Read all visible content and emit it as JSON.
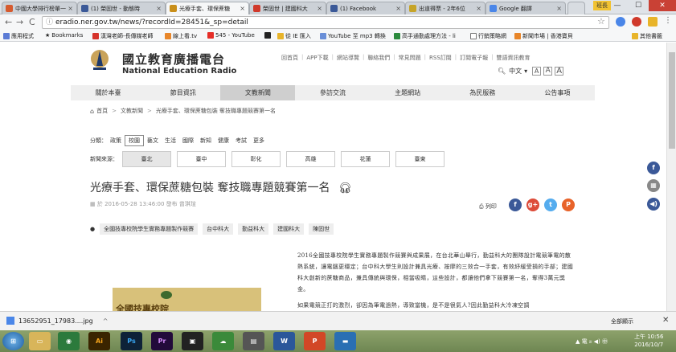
{
  "browser": {
    "tabs": [
      {
        "label": "中國大學排行榜單一",
        "color": "#d65b2f",
        "active": false
      },
      {
        "label": "(1) 榮固世 - 動態時",
        "color": "#3b5998",
        "active": false
      },
      {
        "label": "光療手套、環保蔗糖",
        "color": "#c98f1a",
        "active": true
      },
      {
        "label": "榮固世 | 建國科大",
        "color": "#d0392b",
        "active": false
      },
      {
        "label": "(1) Facebook",
        "color": "#3b5998",
        "active": false
      },
      {
        "label": "出道得票 - 2年6位",
        "color": "#c6a428",
        "active": false
      },
      {
        "label": "Google 翻譯",
        "color": "#4a86e8",
        "active": false
      }
    ],
    "profile_label": "班長",
    "url": "eradio.ner.gov.tw/news/?recordId=28451&_sp=detail",
    "bookmarks": [
      {
        "label": "應用程式",
        "color": "#5b7bd5"
      },
      {
        "label": "Bookmarks",
        "color": "#333333"
      },
      {
        "label": "漢灣老師-長傳媒老師",
        "color": "#d6332b"
      },
      {
        "label": "線上看.tv",
        "color": "#e8862a"
      },
      {
        "label": "545 - YouTube",
        "color": "#e52d27"
      },
      {
        "label": "",
        "color": "#222222"
      },
      {
        "label": "從 IE 匯入",
        "color": "#e8b42a"
      },
      {
        "label": "YouTube 至 mp3 轉換",
        "color": "#6a8fd8"
      },
      {
        "label": "高手通勤處理方法 - li",
        "color": "#2b8a3e"
      },
      {
        "label": "行銷策略網",
        "color": "#777777"
      },
      {
        "label": "新聞市場 | 香港寶貝",
        "color": "#e8862a"
      }
    ],
    "other_bookmarks": "其他書籤"
  },
  "site": {
    "name_zh": "國立教育廣播電台",
    "name_en": "National Education Radio",
    "top_links": [
      "回首頁",
      "APP下載",
      "網站導覽",
      "聯絡我們",
      "常見問題",
      "RSS訂閱",
      "訂閱電子報",
      "雙語資訊教育"
    ],
    "language": "中文",
    "font_sizes": [
      "A",
      "A",
      "A"
    ],
    "nav": [
      "關於本臺",
      "節目資訊",
      "文教新聞",
      "參訪交流",
      "主題網站",
      "為民服務",
      "公告事項"
    ],
    "nav_active_index": 2
  },
  "breadcrumb": [
    "首頁",
    "文教新聞",
    "光療手套、環保蔗糖包裝 奪技職專題競賽第一名"
  ],
  "categories": {
    "label": "分類：",
    "items": [
      "政策",
      "校園",
      "藝文",
      "生活",
      "國際",
      "新知",
      "健康",
      "考試",
      "更多"
    ],
    "active_index": 1
  },
  "regions": {
    "label": "新聞來源：",
    "items": [
      "臺北",
      "臺中",
      "彰化",
      "高雄",
      "花蓮",
      "臺東"
    ],
    "active_index": 0
  },
  "article": {
    "title": "光療手套、環保蔗糖包裝 奪技職專題競賽第一名",
    "meta": "於 2016-05-28 13:46:00 發布 曾琪瑄",
    "print_label": "列印",
    "tags": [
      "全國技專校院學生實務專題製作競賽",
      "台中科大",
      "勤益科大",
      "建國科大",
      "陳固世"
    ],
    "paragraphs": [
      "2016全國技專校院學生實務專題製作競賽與成果展，在台北華山舉行，勤益科大的團隊設計電競筆電的散熱系統，讓電腦更穩定；台中科大學生則設計兼具光療、按摩的三效合一手套，有效紓緩受損的手部；建國科大創新的蔗糖商品，兼具傳統與環保，相當吸睛，這些設計，都讓他們拿下競賽第一名，奪得3萬元獎金。",
      "如果電競正打的激烈，卻因為筆電過熱，導致當機，是不是很氣人?因此勤益科大冷凍空調"
    ],
    "poster_text": "全國技專校院"
  },
  "download": {
    "file": "13652951_17983....jpg",
    "show_all": "全部顯示"
  },
  "taskbar": {
    "clock_time": "上午 10:56",
    "clock_date": "2016/10/7",
    "tray": "▲ 電 ᵢₗₗ ◀) ㊥"
  }
}
